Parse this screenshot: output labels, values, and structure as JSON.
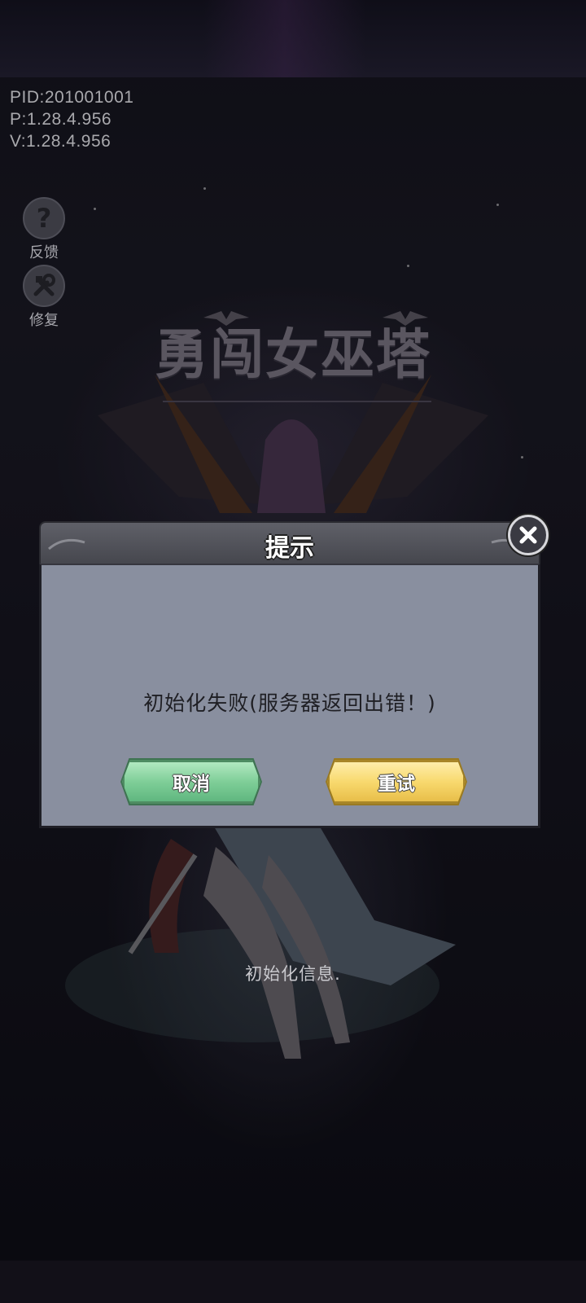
{
  "version_info": {
    "pid": "PID:201001001",
    "p": "P:1.28.4.956",
    "v": "V:1.28.4.956"
  },
  "side_buttons": [
    {
      "label": "反馈",
      "icon": "question-icon"
    },
    {
      "label": "修复",
      "icon": "tools-icon"
    }
  ],
  "logo": {
    "title": "勇闯女巫塔"
  },
  "dialog": {
    "title": "提示",
    "message": "初始化失败(服务器返回出错！)",
    "cancel_label": "取消",
    "retry_label": "重试",
    "close_icon": "close-icon"
  },
  "loading": {
    "status": "初始化信息."
  },
  "colors": {
    "dialog_body": "#898f9f",
    "cancel_button": "#7fce98",
    "retry_button": "#f8d96e"
  }
}
